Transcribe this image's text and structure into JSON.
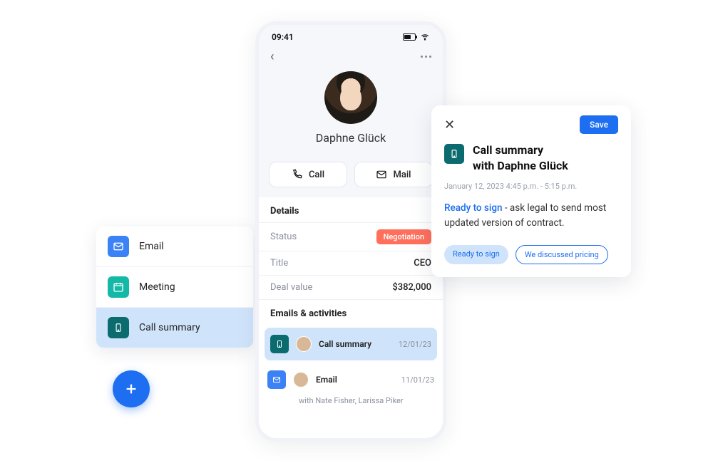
{
  "phone": {
    "time": "09:41",
    "contact_name": "Daphne Glück",
    "call_label": "Call",
    "mail_label": "Mail",
    "details_heading": "Details",
    "rows": {
      "status": {
        "label": "Status",
        "value": "Negotiation"
      },
      "title": {
        "label": "Title",
        "value": "CEO"
      },
      "deal": {
        "label": "Deal value",
        "value": "$382,000"
      }
    },
    "activities_heading": "Emails & activities",
    "activities": [
      {
        "type": "Call summary",
        "date": "12/01/23"
      },
      {
        "type": "Email",
        "date": "11/01/23",
        "subtitle": "with Nate Fisher, Larissa Piker"
      }
    ]
  },
  "menu": {
    "items": [
      {
        "label": "Email"
      },
      {
        "label": "Meeting"
      },
      {
        "label": "Call summary"
      }
    ]
  },
  "summary": {
    "save_label": "Save",
    "title_line1": "Call summary",
    "title_line2": "with Daphne Glück",
    "date": "January 12, 2023  4:45 p.m. - 5:15 p.m.",
    "highlight": "Ready to sign",
    "body_rest": " - ask legal to send most updated version of contract.",
    "tags": {
      "primary": "Ready to sign",
      "secondary": "We discussed pricing"
    }
  }
}
